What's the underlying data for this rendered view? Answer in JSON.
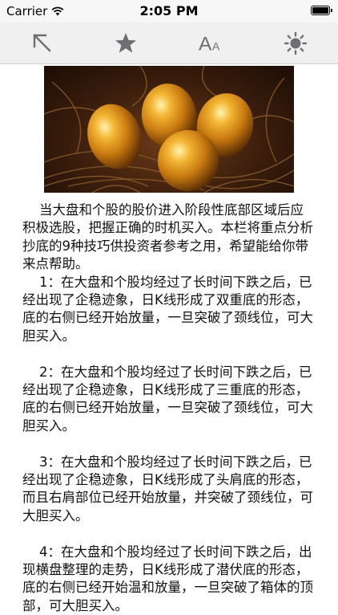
{
  "status_bar": {
    "carrier": "Carrier",
    "time": "2:05 PM"
  },
  "toolbar": {
    "buttons": [
      {
        "name": "back",
        "icon": "arrow-up-left-icon"
      },
      {
        "name": "favorite",
        "icon": "star-icon"
      },
      {
        "name": "font-size",
        "icon": "font-size-icon",
        "label": "A"
      },
      {
        "name": "brightness",
        "icon": "brightness-icon"
      }
    ]
  },
  "article": {
    "paragraphs": [
      "    当大盘和个股的股价进入阶段性底部区域后应积极选股，把握正确的时机买入。本栏将重点分析抄底的9种技巧供投资者参考之用，希望能给你带来点帮助。",
      "    1：在大盘和个股均经过了长时间下跌之后，已经出现了企稳迹象，日K线形成了双重底的形态，底的右侧已经开始放量，一旦突破了颈线位，可大胆买入。",
      "    2：在大盘和个股均经过了长时间下跌之后，已经出现了企稳迹象，日K线形成了三重底的形态，底的右侧已经开始放量，一旦突破了颈线位，可大胆买入。",
      "    3：在大盘和个股均经过了长时间下跌之后，已经出现了企稳迹象，日K线形成了头肩底的形态，而且右肩部位已经开始放量，并突破了颈线位，可大胆买入。",
      "    4：在大盘和个股均经过了长时间下跌之后，出现横盘整理的走势，日K线形成了潜伏底的形态，底的右侧已经开始温和放量，一旦突破了箱体的顶部，可大胆买入。"
    ]
  },
  "colors": {
    "toolbar_icon": "#6e6e73",
    "toolbar_bg": "#f0f0f0"
  }
}
